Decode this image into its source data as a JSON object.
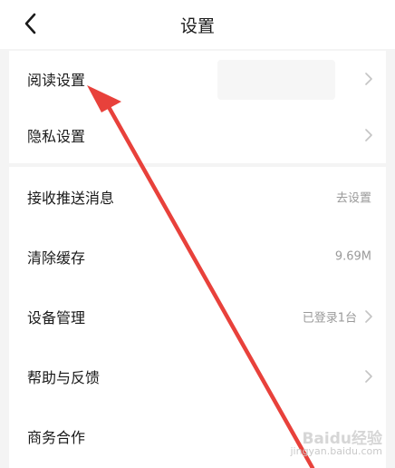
{
  "header": {
    "title": "设置",
    "back_icon": "chevron-left-icon"
  },
  "group1": [
    {
      "label": "阅读设置",
      "value": "",
      "chevron": true
    },
    {
      "label": "隐私设置",
      "value": "",
      "chevron": true
    }
  ],
  "group2": [
    {
      "label": "接收推送消息",
      "value": "去设置",
      "chevron": false
    },
    {
      "label": "清除缓存",
      "value": "9.69M",
      "chevron": false
    },
    {
      "label": "设备管理",
      "value": "已登录1台",
      "chevron": true
    },
    {
      "label": "帮助与反馈",
      "value": "",
      "chevron": true
    },
    {
      "label": "商务合作",
      "value": "",
      "chevron": false
    }
  ],
  "annotation": {
    "arrow_color": "#e8413b",
    "arrow_icon": "annotation-arrow"
  },
  "watermark": {
    "brand": "Baidu经验",
    "url": "jingyan.baidu.com"
  }
}
